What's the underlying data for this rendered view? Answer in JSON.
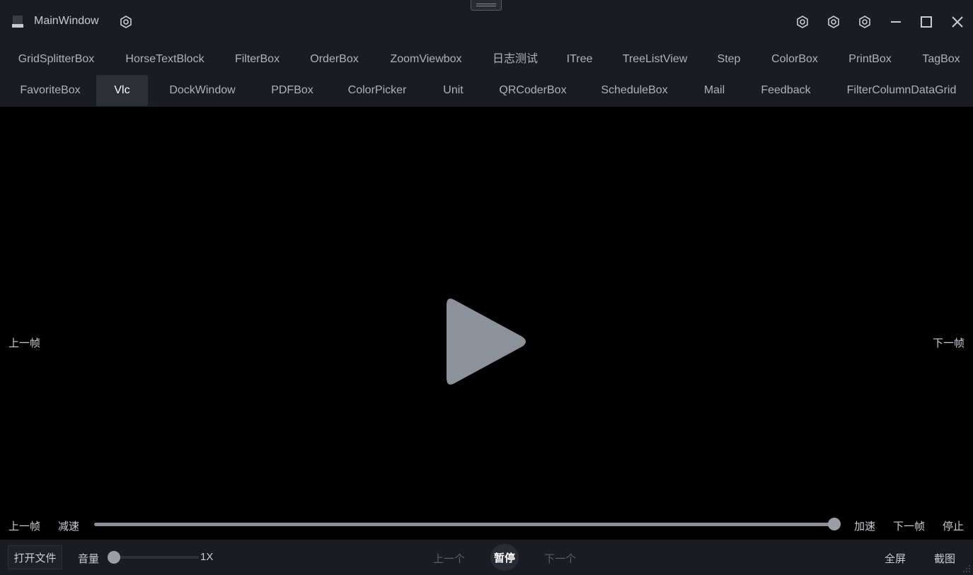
{
  "window": {
    "title": "MainWindow",
    "icons": [
      "app-icon",
      "settings-gear-icon",
      "theme-icon",
      "skin-icon",
      "settings-icon",
      "minimize-icon",
      "maximize-icon",
      "close-icon"
    ]
  },
  "tabs_row1": [
    "GridSplitterBox",
    "HorseTextBlock",
    "FilterBox",
    "OrderBox",
    "ZoomViewbox",
    "日志测试",
    "ITree",
    "TreeListView",
    "Step",
    "ColorBox",
    "PrintBox",
    "TagBox"
  ],
  "tabs_row2": [
    "FavoriteBox",
    "Vlc",
    "DockWindow",
    "PDFBox",
    "ColorPicker",
    "Unit",
    "QRCoderBox",
    "ScheduleBox",
    "Mail",
    "Feedback",
    "FilterColumnDataGrid"
  ],
  "active_tab": "Vlc",
  "video": {
    "prev_frame_side": "上一帧",
    "next_frame_side": "下一帧",
    "controls": {
      "prev_frame": "上一帧",
      "slow_down": "减速",
      "speed_up": "加速",
      "next_frame": "下一帧",
      "stop": "停止"
    },
    "progress_fraction": 1.0
  },
  "bottom": {
    "open_file": "打开文件",
    "volume_label": "音量",
    "volume_fraction": 0.0,
    "speed": "1X",
    "previous": "上一个",
    "pause": "暂停",
    "next": "下一个",
    "fullscreen": "全屏",
    "screenshot": "截图"
  },
  "colors": {
    "background": "#1b1c21",
    "video_bg": "#000000",
    "active_tab_bg": "#2d2f37",
    "play_icon": "#8c919c"
  }
}
